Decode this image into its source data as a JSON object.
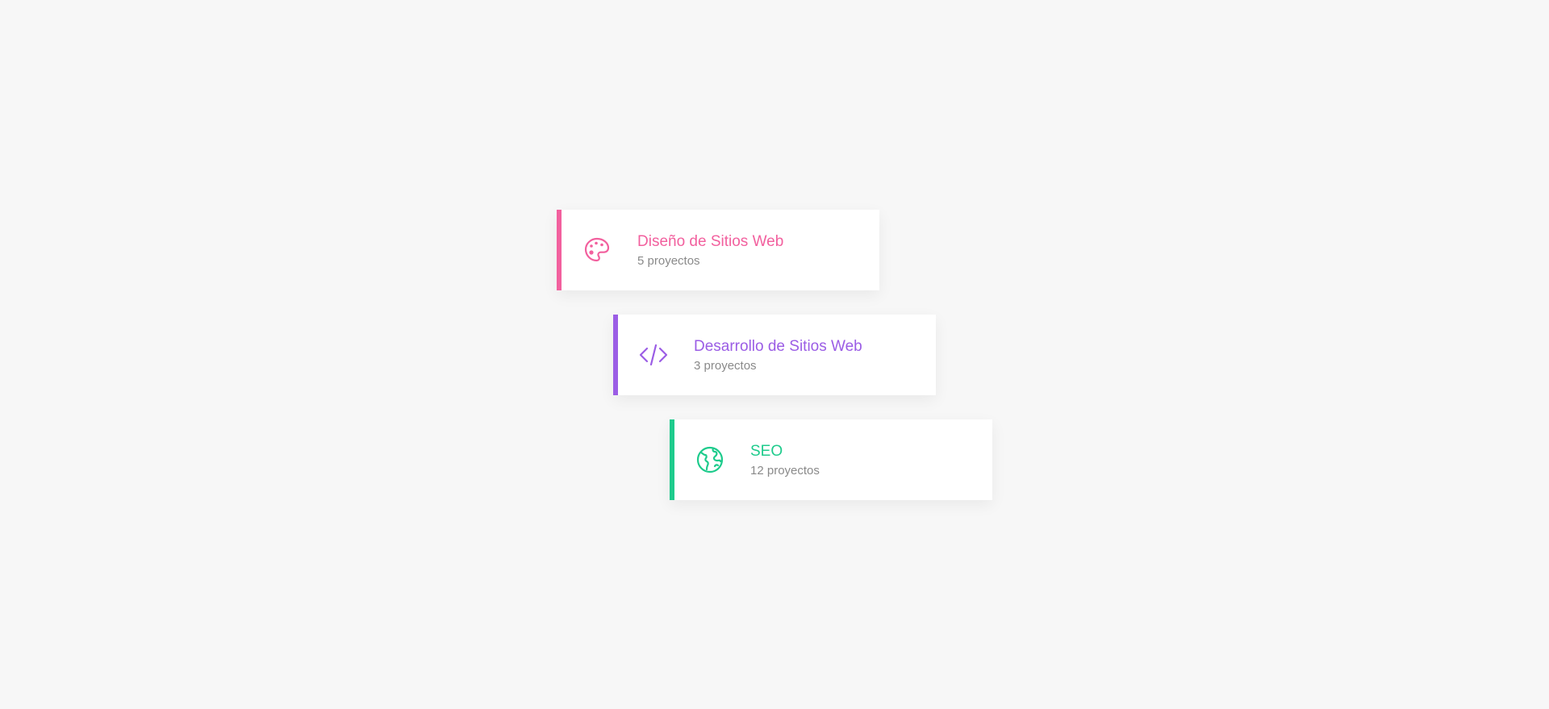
{
  "cards": [
    {
      "title": "Diseño de Sitios Web",
      "subtitle": "5 proyectos",
      "icon": "palette-icon",
      "color": "#f2609e"
    },
    {
      "title": "Desarrollo de Sitios Web",
      "subtitle": "3 proyectos",
      "icon": "code-icon",
      "color": "#9b5de5"
    },
    {
      "title": "SEO",
      "subtitle": "12 proyectos",
      "icon": "globe-icon",
      "color": "#1ecb8c"
    }
  ],
  "background": "#f7f7f7"
}
